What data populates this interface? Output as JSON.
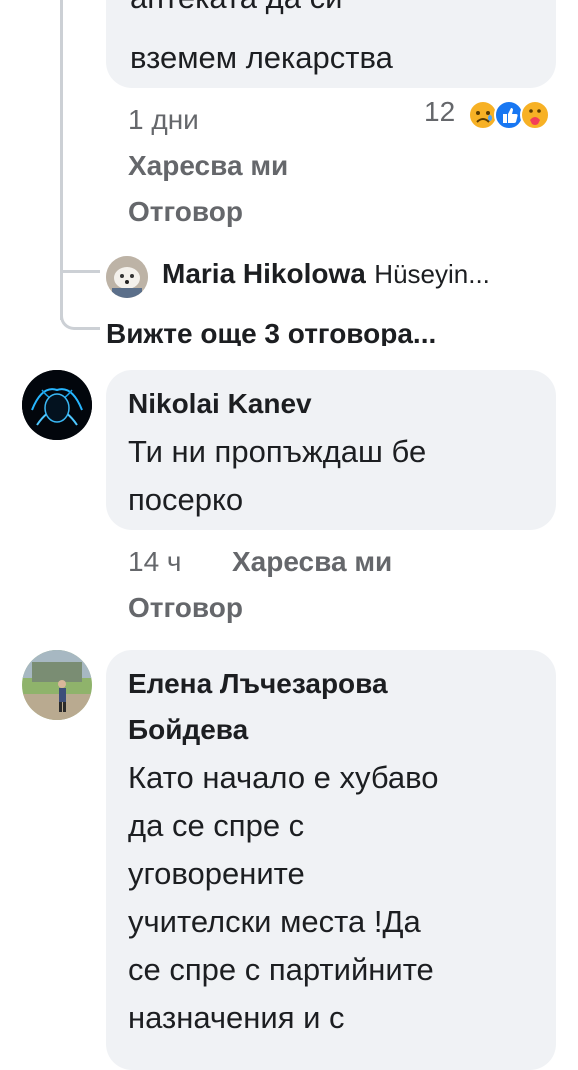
{
  "comment1": {
    "text_cut": "аптеката да си",
    "text_last": "вземем лекарства",
    "age": "1 дни",
    "like_label": "Харесва ми",
    "reply_label": "Отговор",
    "reaction_count": "12",
    "reactions": [
      "sad-reaction-icon",
      "like-reaction-icon",
      "care-reaction-icon"
    ]
  },
  "reply_preview": {
    "author": "Maria Hikolowa",
    "snippet": "Hüseyin..."
  },
  "more_replies": "Вижте още 3 отговора...",
  "comment2": {
    "author": "Nikolai Kanev",
    "line1": "Ти ни пропъждаш бе",
    "line2": "посерко",
    "age": "14 ч",
    "like_label": "Харесва ми",
    "reply_label": "Отговор"
  },
  "comment3": {
    "author_line1": "Елена Лъчезарова",
    "author_line2": "Бойдева",
    "lines": [
      "Като начало е хубаво",
      "да се спре с",
      "уговорените",
      "учителски места !Да",
      "се спре с партийните",
      "назначения и с"
    ]
  },
  "colors": {
    "bubble": "#f0f2f5",
    "meta": "#65676b",
    "like": "#1877f2",
    "sad": "#f7b125",
    "care": "#f7b125"
  }
}
